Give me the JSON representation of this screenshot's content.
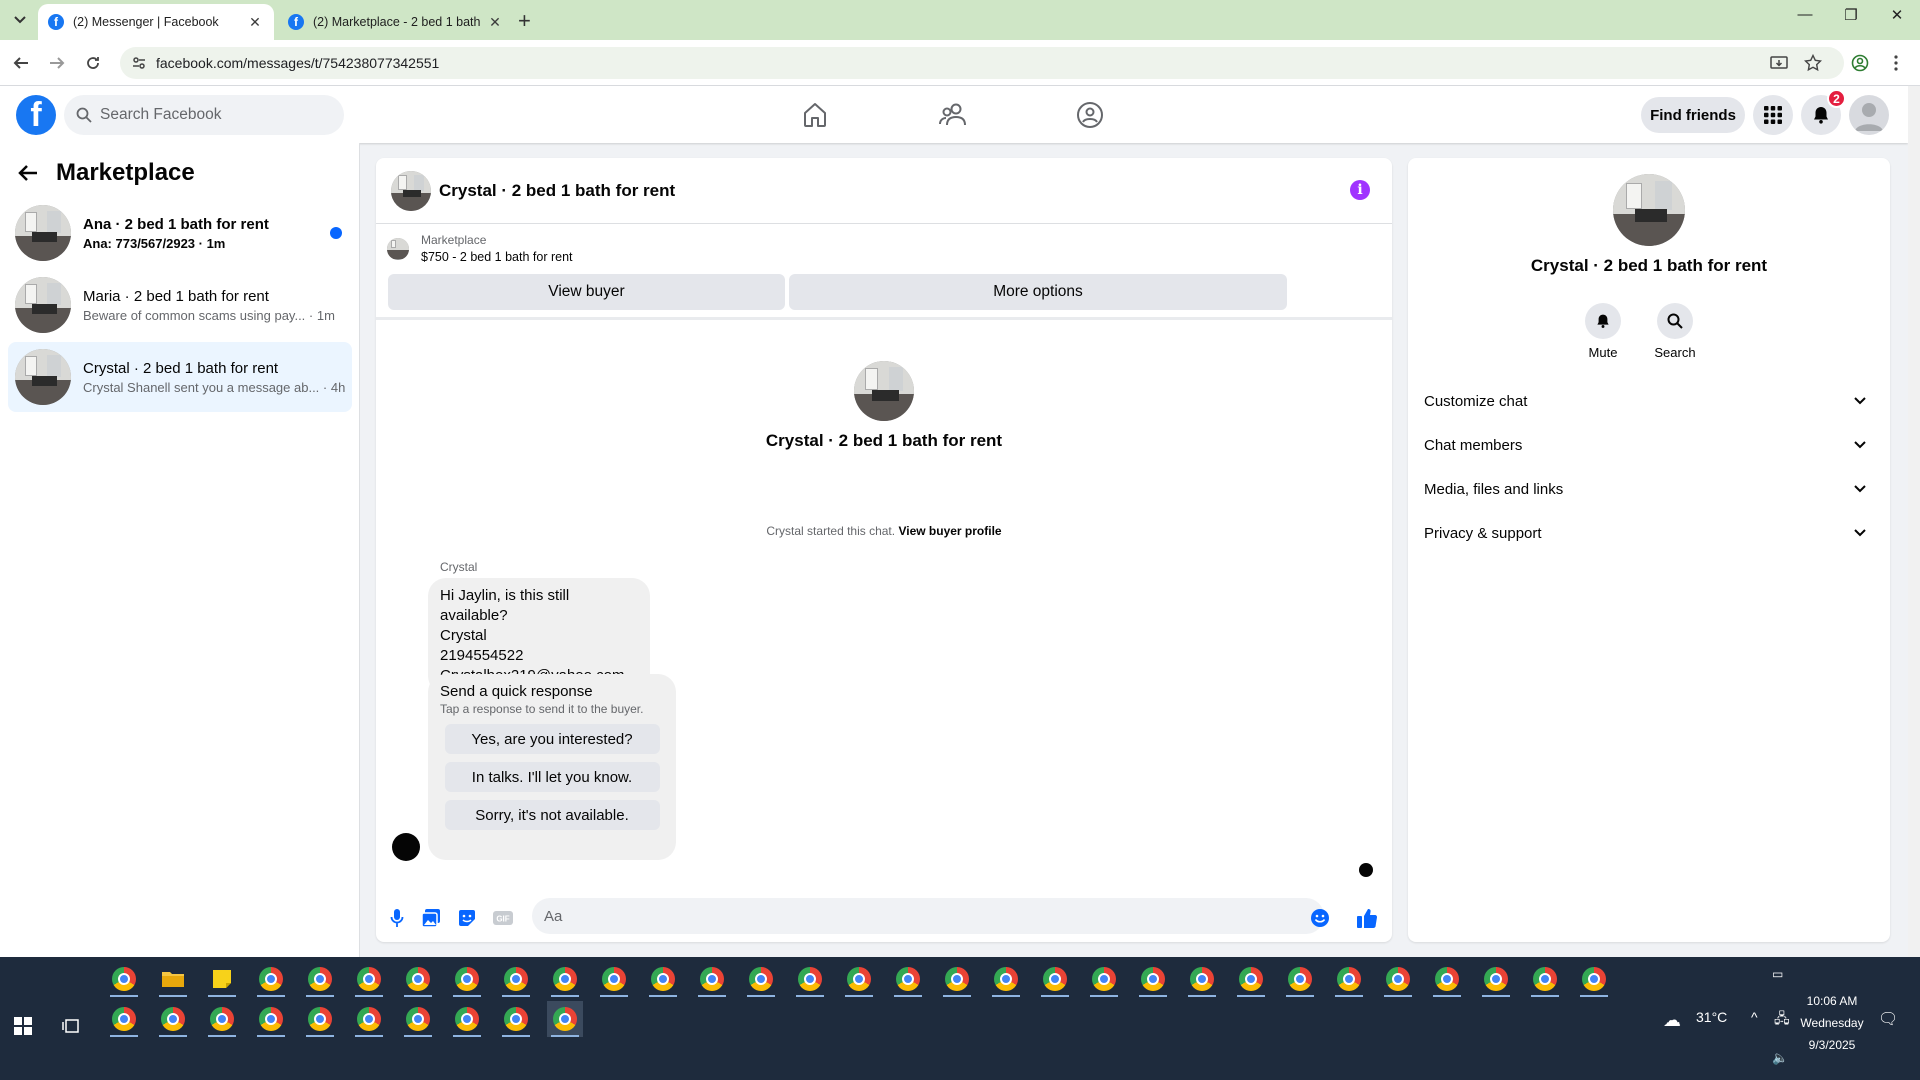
{
  "browser": {
    "tabs": [
      {
        "title": "(2) Messenger | Facebook",
        "active": true
      },
      {
        "title": "(2) Marketplace - 2 bed 1 bath",
        "active": false
      }
    ],
    "url": "facebook.com/messages/t/754238077342551"
  },
  "fb": {
    "logo_letter": "f",
    "search_placeholder": "Search Facebook",
    "find_friends_label": "Find friends",
    "notification_count": "2",
    "brand_color": "#1877f2"
  },
  "left": {
    "title": "Marketplace",
    "conversations": [
      {
        "name": "Ana · 2 bed 1 bath for rent",
        "snippet": "Ana: 773/567/2923 · 1m",
        "unread": true
      },
      {
        "name": "Maria · 2 bed 1 bath for rent",
        "snippet": "Beware of common scams using pay... · 1m",
        "unread": false
      },
      {
        "name": "Crystal · 2 bed 1 bath for rent",
        "snippet": "Crystal Shanell sent you a message ab... · 4h",
        "unread": false,
        "active": true
      }
    ]
  },
  "chat": {
    "header_name": "Crystal · 2 bed 1 bath for rent",
    "marketplace_label": "Marketplace",
    "listing": "$750 - 2 bed 1 bath for rent",
    "view_buyer_label": "View buyer",
    "more_options_label": "More options",
    "intro_name": "Crystal · 2 bed 1 bath for rent",
    "started_text": "Crystal started this chat.",
    "view_buyer_profile_label": "View buyer profile",
    "sender": "Crystal",
    "message_lines": [
      "Hi Jaylin, is this still available?",
      "Crystal",
      "2194554522",
      "Crystalbox219@yahoo.com"
    ],
    "quick_response_title": "Send a quick response",
    "quick_response_sub": "Tap a response to send it to the buyer.",
    "quick_responses": [
      "Yes, are you interested?",
      "In talks. I'll let you know.",
      "Sorry, it's not available."
    ],
    "composer_placeholder": "Aa"
  },
  "details": {
    "name": "Crystal · 2 bed 1 bath for rent",
    "mute_label": "Mute",
    "search_label": "Search",
    "sections": [
      "Customize chat",
      "Chat members",
      "Media, files and links",
      "Privacy & support"
    ]
  },
  "taskbar": {
    "temperature": "31°C",
    "time": "10:06 AM",
    "day": "Wednesday",
    "date": "9/3/2025"
  }
}
